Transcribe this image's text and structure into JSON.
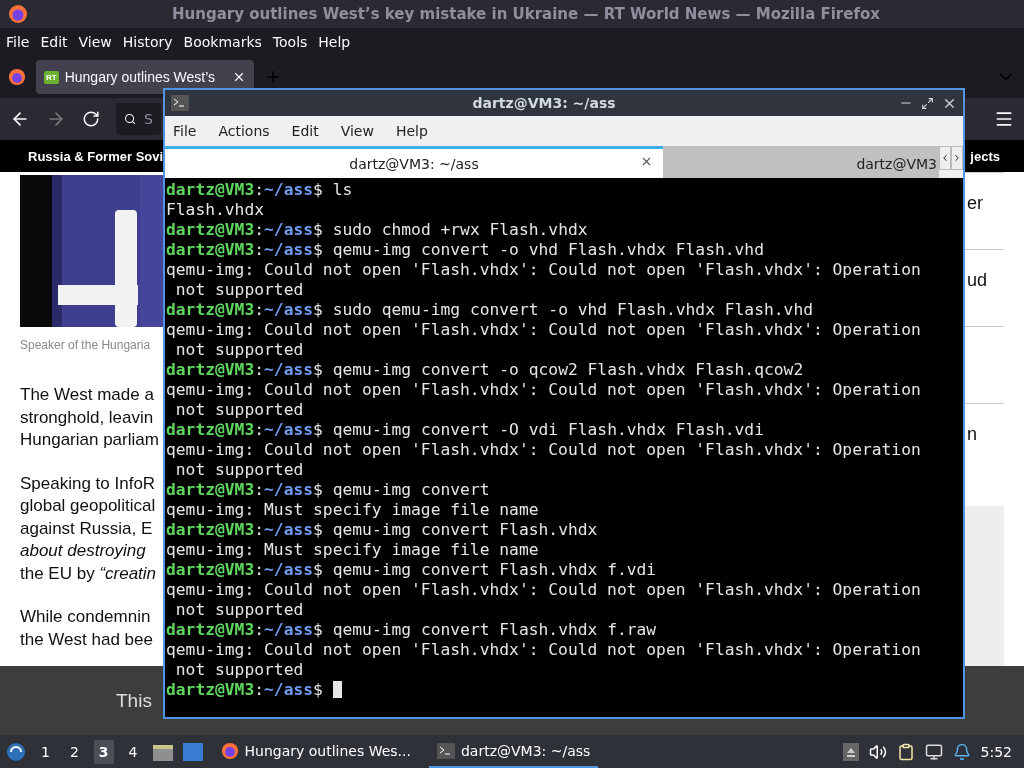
{
  "browser": {
    "title": "Hungary outlines West’s key mistake in Ukraine — RT World News — Mozilla Firefox",
    "menu": [
      "File",
      "Edit",
      "View",
      "History",
      "Bookmarks",
      "Tools",
      "Help"
    ],
    "tabs": [
      {
        "label": "Hungary outlines West’s",
        "favicon": "RT",
        "selected": true
      }
    ],
    "address_placeholder": "S",
    "site_nav": {
      "left": "Russia & Former Sovi",
      "right": "jects"
    },
    "article": {
      "caption": "Speaker of the Hungaria",
      "paragraphs": [
        [
          "The West made a",
          "stronghold, leavin",
          "Hungarian parliam"
        ],
        [
          "Speaking to InfoR",
          "global geopolitical",
          "against Russia, E",
          "*about destroying*",
          "the EU by *“creatin*"
        ],
        [
          "While condemnin",
          "the West had bee"
        ]
      ],
      "side_items": [
        {
          "kind": "text",
          "text": "er"
        },
        {
          "kind": "text",
          "text": "ud"
        },
        {
          "kind": "blank"
        },
        {
          "kind": "text",
          "text": "n"
        }
      ]
    },
    "banner": "This"
  },
  "terminal": {
    "title": "dartz@VM3: ~/ass",
    "menu": [
      "File",
      "Actions",
      "Edit",
      "View",
      "Help"
    ],
    "tabs": [
      {
        "label": "dartz@VM3: ~/ass",
        "selected": true
      },
      {
        "label": "dartz@VM3",
        "selected": false
      }
    ],
    "lines": [
      {
        "kind": "prompt",
        "user": "dartz@VM3",
        "sep": ":",
        "path": "~/ass",
        "sign": "$",
        "command": "ls"
      },
      {
        "kind": "output",
        "text": "Flash.vhdx"
      },
      {
        "kind": "prompt",
        "user": "dartz@VM3",
        "sep": ":",
        "path": "~/ass",
        "sign": "$",
        "command": "sudo chmod +rwx Flash.vhdx"
      },
      {
        "kind": "prompt",
        "user": "dartz@VM3",
        "sep": ":",
        "path": "~/ass",
        "sign": "$",
        "command": "qemu-img convert -o vhd Flash.vhdx Flash.vhd"
      },
      {
        "kind": "output",
        "text": "qemu-img: Could not open 'Flash.vhdx': Could not open 'Flash.vhdx': Operation"
      },
      {
        "kind": "output",
        "text": " not supported"
      },
      {
        "kind": "prompt",
        "user": "dartz@VM3",
        "sep": ":",
        "path": "~/ass",
        "sign": "$",
        "command": "sudo qemu-img convert -o vhd Flash.vhdx Flash.vhd"
      },
      {
        "kind": "output",
        "text": "qemu-img: Could not open 'Flash.vhdx': Could not open 'Flash.vhdx': Operation"
      },
      {
        "kind": "output",
        "text": " not supported"
      },
      {
        "kind": "prompt",
        "user": "dartz@VM3",
        "sep": ":",
        "path": "~/ass",
        "sign": "$",
        "command": "qemu-img convert -o qcow2 Flash.vhdx Flash.qcow2"
      },
      {
        "kind": "output",
        "text": "qemu-img: Could not open 'Flash.vhdx': Could not open 'Flash.vhdx': Operation"
      },
      {
        "kind": "output",
        "text": " not supported"
      },
      {
        "kind": "prompt",
        "user": "dartz@VM3",
        "sep": ":",
        "path": "~/ass",
        "sign": "$",
        "command": "qemu-img convert -O vdi Flash.vhdx Flash.vdi"
      },
      {
        "kind": "output",
        "text": "qemu-img: Could not open 'Flash.vhdx': Could not open 'Flash.vhdx': Operation"
      },
      {
        "kind": "output",
        "text": " not supported"
      },
      {
        "kind": "prompt",
        "user": "dartz@VM3",
        "sep": ":",
        "path": "~/ass",
        "sign": "$",
        "command": "qemu-img convert"
      },
      {
        "kind": "output",
        "text": "qemu-img: Must specify image file name"
      },
      {
        "kind": "prompt",
        "user": "dartz@VM3",
        "sep": ":",
        "path": "~/ass",
        "sign": "$",
        "command": "qemu-img convert Flash.vhdx"
      },
      {
        "kind": "output",
        "text": "qemu-img: Must specify image file name"
      },
      {
        "kind": "prompt",
        "user": "dartz@VM3",
        "sep": ":",
        "path": "~/ass",
        "sign": "$",
        "command": "qemu-img convert Flash.vhdx f.vdi"
      },
      {
        "kind": "output",
        "text": "qemu-img: Could not open 'Flash.vhdx': Could not open 'Flash.vhdx': Operation"
      },
      {
        "kind": "output",
        "text": " not supported"
      },
      {
        "kind": "prompt",
        "user": "dartz@VM3",
        "sep": ":",
        "path": "~/ass",
        "sign": "$",
        "command": "qemu-img convert Flash.vhdx f.raw"
      },
      {
        "kind": "output",
        "text": "qemu-img: Could not open 'Flash.vhdx': Could not open 'Flash.vhdx': Operation"
      },
      {
        "kind": "output",
        "text": " not supported"
      },
      {
        "kind": "active_prompt",
        "user": "dartz@VM3",
        "sep": ":",
        "path": "~/ass",
        "sign": "$"
      }
    ]
  },
  "taskbar": {
    "workspaces": [
      {
        "label": "1",
        "selected": false
      },
      {
        "label": "2",
        "selected": false
      },
      {
        "label": "3",
        "selected": true
      },
      {
        "label": "4",
        "selected": false
      }
    ],
    "tasks": [
      {
        "kind": "browser",
        "label": "Hungary outlines Wes...",
        "selected": false
      },
      {
        "kind": "terminal",
        "label": "dartz@VM3: ~/ass",
        "selected": true
      }
    ],
    "clock": "5:52"
  }
}
